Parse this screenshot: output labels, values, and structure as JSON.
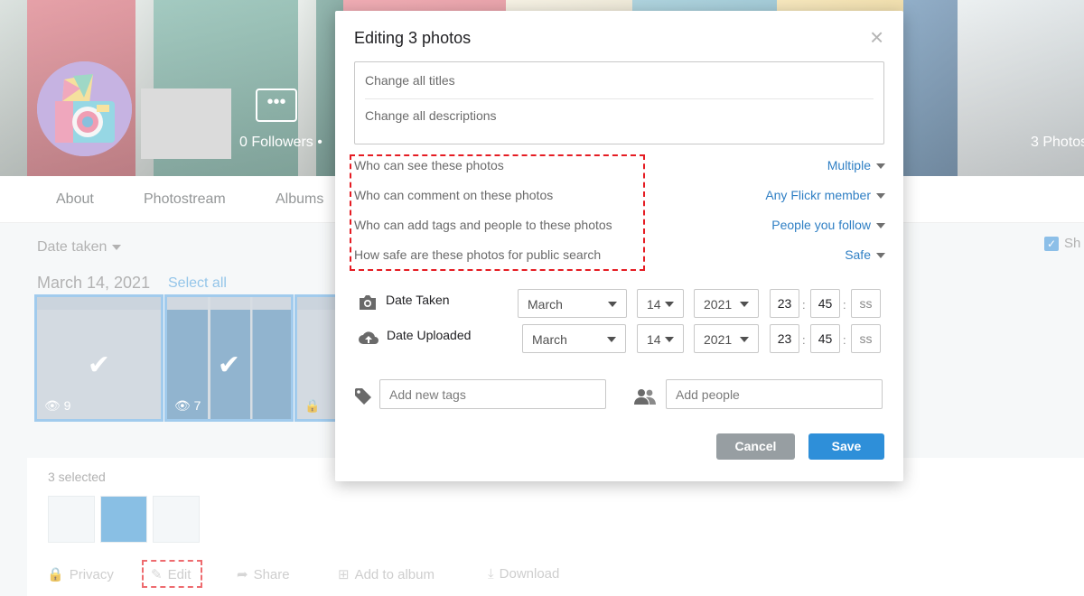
{
  "profile": {
    "followers": "0 Followers",
    "photos_count": "3 Photos",
    "more_label": "•••"
  },
  "subnav": {
    "about": "About",
    "photostream": "Photostream",
    "albums": "Albums"
  },
  "photostream": {
    "sort_label": "Date taken",
    "show_label": "Sh",
    "group_date": "March 14, 2021",
    "select_all": "Select all",
    "thumbs": [
      {
        "views": "9"
      },
      {
        "views": "7"
      }
    ]
  },
  "selection": {
    "count": "3 selected",
    "actions": {
      "privacy": "Privacy",
      "edit": "Edit",
      "share": "Share",
      "add_to_album": "Add to album",
      "download": "Download"
    }
  },
  "modal": {
    "title": "Editing 3 photos",
    "titles_placeholder": "Change all titles",
    "descriptions_placeholder": "Change all descriptions",
    "permissions": [
      {
        "label": "Who can see these photos",
        "value": "Multiple"
      },
      {
        "label": "Who can comment on these photos",
        "value": "Any Flickr member"
      },
      {
        "label": "Who can add tags and people to these photos",
        "value": "People you follow"
      },
      {
        "label": "How safe are these photos for public search",
        "value": "Safe"
      }
    ],
    "date_taken": {
      "label": "Date Taken",
      "month": "March",
      "day": "14",
      "year": "2021",
      "hour": "23",
      "minute": "45",
      "second": "ss"
    },
    "date_uploaded": {
      "label": "Date Uploaded",
      "month": "March",
      "day": "14",
      "year": "2021",
      "hour": "23",
      "minute": "45",
      "second": "ss"
    },
    "tags_placeholder": "Add new tags",
    "people_placeholder": "Add people",
    "cancel": "Cancel",
    "save": "Save"
  },
  "colors": {
    "accent_blue": "#2e8fd9",
    "link_blue": "#2f7fc4",
    "cancel_gray": "#979ea2",
    "highlight_red": "#e51c23"
  }
}
